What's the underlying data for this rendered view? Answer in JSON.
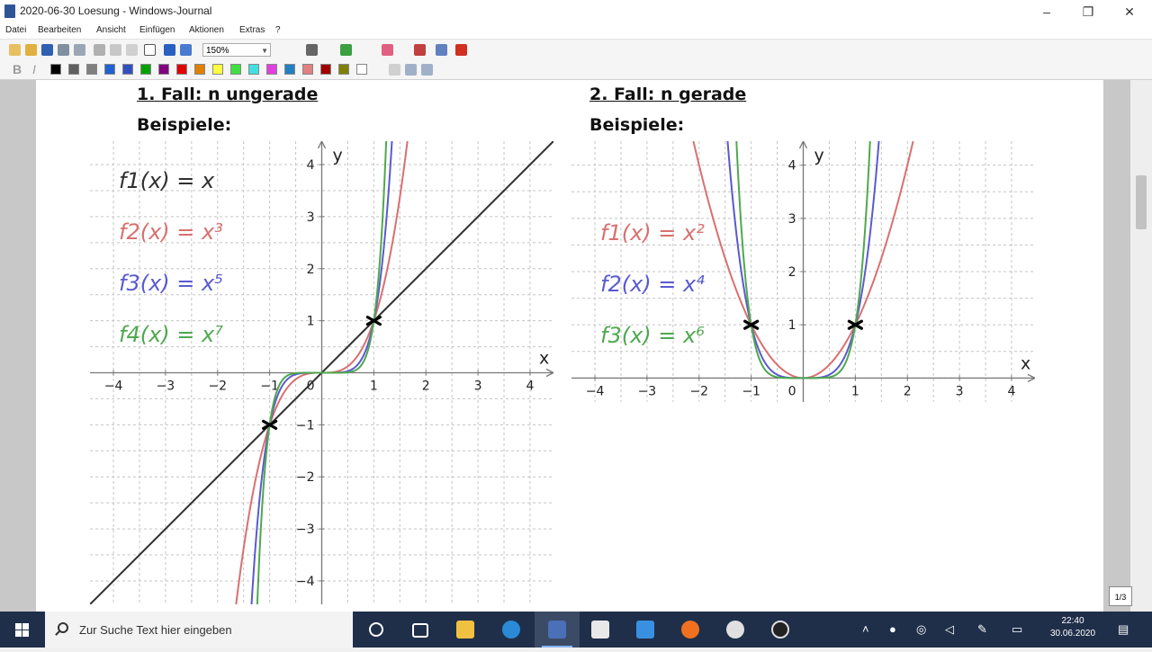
{
  "window": {
    "title": "2020-06-30 Loesung - Windows-Journal",
    "minimize": "–",
    "restore": "❐",
    "close": "✕"
  },
  "menu": [
    "Datei",
    "Bearbeiten",
    "Ansicht",
    "Einfügen",
    "Aktionen",
    "Extras",
    "?"
  ],
  "toolbar": {
    "zoom": "150%",
    "bold": "B",
    "italic": "I"
  },
  "palette": [
    "#000000",
    "#606060",
    "#808080",
    "#2060d0",
    "#3050c0",
    "#00a000",
    "#800080",
    "#e00000",
    "#e08000",
    "#ffff40",
    "#40e040",
    "#40e0e0",
    "#e040e0",
    "#2080c0",
    "#e08080",
    "#a00000",
    "#808000",
    "#ffffff"
  ],
  "page_indicator": "1/3",
  "left": {
    "heading": "1. Fall: n ungerade",
    "subheading": "Beispiele:",
    "chart_data": {
      "type": "line",
      "xlabel": "x",
      "ylabel": "y",
      "xlim": [
        -4.45,
        4.45
      ],
      "ylim": [
        -4.45,
        4.45
      ],
      "x_ticks": [
        -4,
        -3,
        -2,
        -1,
        1,
        2,
        3,
        4
      ],
      "y_ticks": [
        -4,
        -3,
        -2,
        -1,
        1,
        2,
        3,
        4
      ],
      "origin_label": "0",
      "grid": true,
      "series": [
        {
          "name": "f1(x) = x",
          "exponent": 1,
          "color": "#303030"
        },
        {
          "name": "f2(x) = x³",
          "exponent": 3,
          "color": "#d87070"
        },
        {
          "name": "f3(x) = x⁵",
          "exponent": 5,
          "color": "#5a5ad0"
        },
        {
          "name": "f4(x) = x⁷",
          "exponent": 7,
          "color": "#4fa84f"
        }
      ],
      "marked_points": [
        [
          1,
          1
        ],
        [
          -1,
          -1
        ]
      ]
    }
  },
  "right": {
    "heading": "2. Fall: n gerade",
    "subheading": "Beispiele:",
    "chart_data": {
      "type": "line",
      "xlabel": "x",
      "ylabel": "y",
      "xlim": [
        -4.45,
        4.45
      ],
      "ylim": [
        -0.45,
        4.45
      ],
      "x_ticks": [
        -4,
        -3,
        -2,
        -1,
        1,
        2,
        3,
        4
      ],
      "y_ticks": [
        1,
        2,
        3,
        4
      ],
      "origin_label": "0",
      "grid": true,
      "series": [
        {
          "name": "f1(x) = x²",
          "exponent": 2,
          "color": "#d87070"
        },
        {
          "name": "f2(x) = x⁴",
          "exponent": 4,
          "color": "#5a5ad0"
        },
        {
          "name": "f3(x) = x⁶",
          "exponent": 6,
          "color": "#4fa84f"
        }
      ],
      "marked_points": [
        [
          1,
          1
        ],
        [
          -1,
          1
        ]
      ]
    }
  },
  "taskbar": {
    "search_placeholder": "Zur Suche Text hier eingeben",
    "time": "22:40",
    "date": "30.06.2020"
  }
}
